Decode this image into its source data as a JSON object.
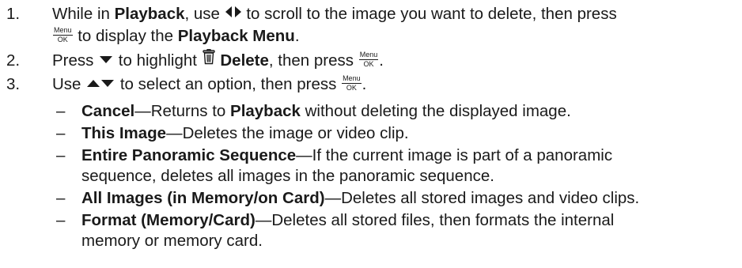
{
  "steps": [
    {
      "num": "1.",
      "line1": {
        "a": "While in ",
        "b": "Playback",
        "c": ", use ",
        "d": " to scroll to the image you want to delete, then press"
      },
      "line2": {
        "a": " to display the ",
        "b": "Playback Menu",
        "c": "."
      }
    },
    {
      "num": "2.",
      "a": "Press ",
      "b": " to highlight ",
      "c": "Delete",
      "d": ", then press ",
      "e": "."
    },
    {
      "num": "3.",
      "a": "Use ",
      "b": " to select an option, then press ",
      "c": "."
    }
  ],
  "menu_ok": {
    "top": "Menu",
    "bottom": "OK"
  },
  "icons": {
    "left_right": "left-right-arrows-icon",
    "down": "down-arrow-icon",
    "up_down": "up-down-arrows-icon",
    "trash": "trash-can-icon",
    "menu_ok": "menu-ok-button-icon"
  },
  "options": [
    {
      "dash": "–",
      "label": "Cancel",
      "desc": "—Returns to ",
      "desc_bold": "Playback",
      "desc_end": " without deleting the displayed image."
    },
    {
      "dash": "–",
      "label": "This Image",
      "desc": "—Deletes the image or video clip."
    },
    {
      "dash": "–",
      "label": "Entire Panoramic Sequence",
      "desc": "—If the current image is part of a panoramic",
      "desc2": "sequence, deletes all images in the panoramic sequence."
    },
    {
      "dash": "–",
      "label": "All Images (in Memory/on Card)",
      "desc": "—Deletes all stored images and video clips."
    },
    {
      "dash": "–",
      "label": "Format (Memory/Card)",
      "desc": "—Deletes all stored files, then formats the internal",
      "desc2": "memory or memory card."
    }
  ]
}
